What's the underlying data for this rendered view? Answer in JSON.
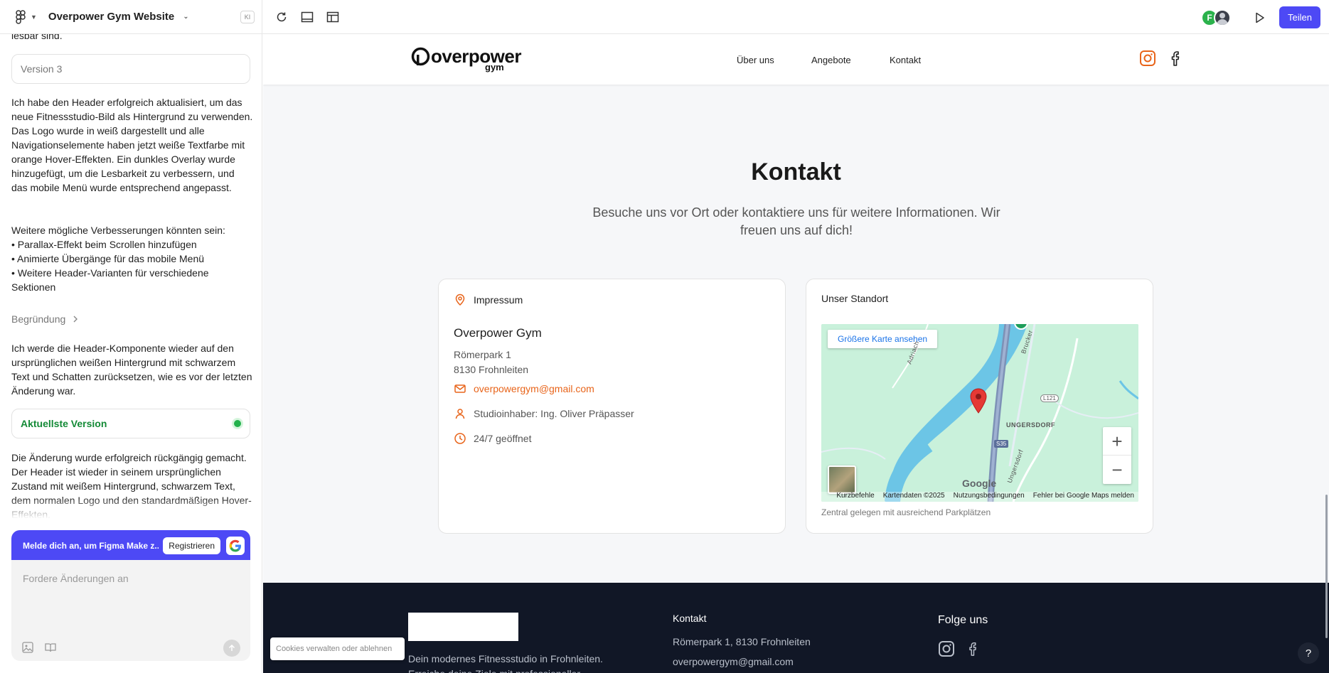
{
  "topbar": {
    "project_title": "Overpower Gym Website",
    "badge": "KI",
    "avatar_initial": "F",
    "share_label": "Teilen"
  },
  "chat": {
    "clipped_line": "lesbar sind.",
    "version_label": "Version 3",
    "message_1": "Ich habe den Header erfolgreich aktualisiert, um das neue Fitnessstudio-Bild als Hintergrund zu verwenden. Das Logo wurde in weiß dargestellt und alle Navigationselemente haben jetzt weiße Textfarbe mit orange Hover-Effekten. Ein dunkles Overlay wurde hinzugefügt, um die Lesbarkeit zu verbessern, und das mobile Menü wurde entsprechend angepasst.",
    "message_2": "Weitere mögliche Verbesserungen könnten sein:\n• Parallax-Effekt beim Scrollen hinzufügen\n• Animierte Übergänge für das mobile Menü\n• Weitere Header-Varianten für verschiedene Sektionen",
    "reason_label": "Begründung",
    "message_3": "Ich werde die Header-Komponente wieder auf den ursprünglichen weißen Hintergrund mit schwarzem Text und Schatten zurücksetzen, wie es vor der letzten Änderung war.",
    "latest_version_label": "Aktuellste Version",
    "message_4": "Die Änderung wurde erfolgreich rückgängig gemacht. Der Header ist wieder in seinem ursprünglichen Zustand mit weißem Hintergrund, schwarzem Text, dem normalen Logo und den standardmäßigen Hover-Effekten.",
    "signup_text": "Melde dich an, um Figma Make z...",
    "register_label": "Registrieren",
    "input_placeholder": "Fordere Änderungen an"
  },
  "site": {
    "logo_word": "overpower",
    "logo_sub": "gym",
    "nav": [
      "Über uns",
      "Angebote",
      "Kontakt"
    ],
    "kontakt_title": "Kontakt",
    "kontakt_subtitle": "Besuche uns vor Ort oder kontaktiere uns für weitere Informationen. Wir freuen uns auf dich!",
    "impressum": {
      "heading": "Impressum",
      "name": "Overpower Gym",
      "street": "Römerpark 1",
      "city": "8130 Frohnleiten",
      "email": "overpowergym@gmail.com",
      "owner": "Studioinhaber: Ing. Oliver Präpasser",
      "hours": "24/7 geöffnet"
    },
    "location": {
      "heading": "Unser Standort",
      "map_button": "Größere Karte ansehen",
      "map_labels": [
        "UNGERSDORF",
        "L121",
        "S35",
        "Ungersdorf",
        "Brucker",
        "Adriach"
      ],
      "attribution": [
        "Kurzbefehle",
        "Kartendaten ©2025",
        "Nutzungsbedingungen",
        "Fehler bei Google Maps melden"
      ],
      "google": "Google",
      "caption": "Zentral gelegen mit ausreichend Parkplätzen"
    },
    "footer": {
      "description": "Dein modernes Fitnessstudio in Frohnleiten. Erreiche deine Ziele mit professioneller",
      "kontakt_heading": "Kontakt",
      "address": "Römerpark 1, 8130 Frohnleiten",
      "email": "overpowergym@gmail.com",
      "follow_heading": "Folge uns"
    },
    "cookie_label": "Cookies verwalten oder ablehnen",
    "help_label": "?"
  },
  "colors": {
    "accent_orange": "#e8641a",
    "primary_purple": "#4d49f5",
    "footer_bg": "#111726",
    "green_status": "#22b24c"
  }
}
